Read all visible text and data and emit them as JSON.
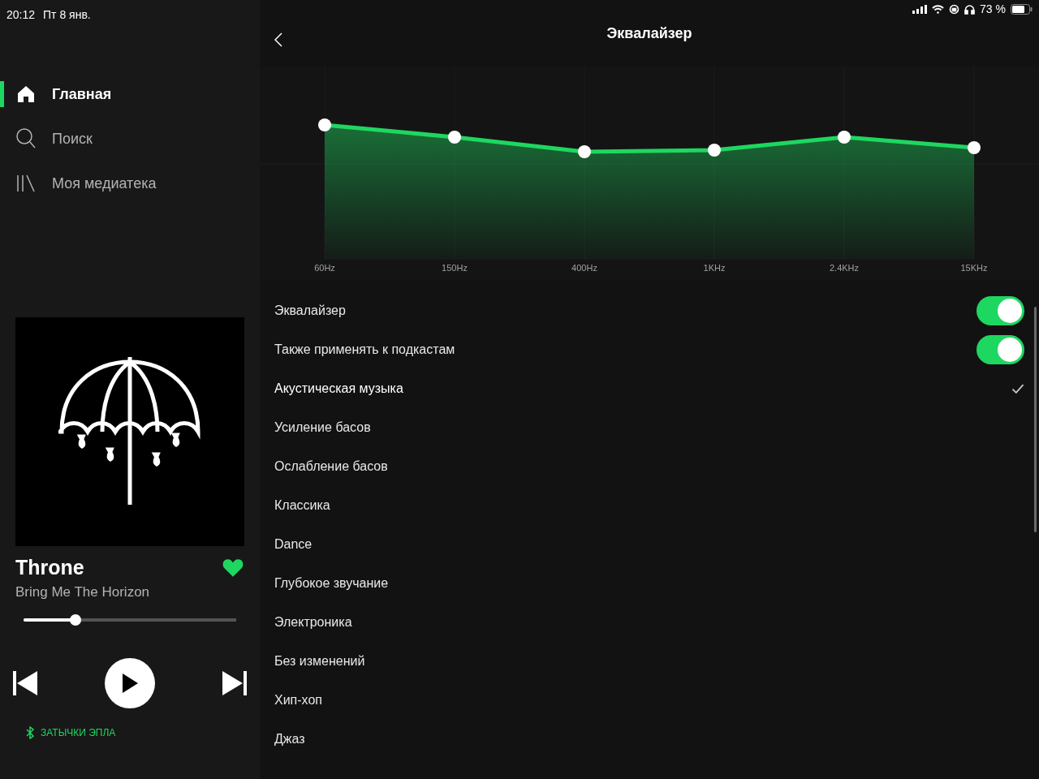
{
  "status_bar": {
    "time": "20:12",
    "date": "Пт 8 янв.",
    "battery_text": "73 %"
  },
  "sidebar": {
    "items": [
      {
        "label": "Главная",
        "selected": true
      },
      {
        "label": "Поиск",
        "selected": false
      },
      {
        "label": "Моя медиатека",
        "selected": false
      }
    ]
  },
  "now_playing": {
    "title": "Throne",
    "artist": "Bring Me The Horizon",
    "liked": true,
    "progress": {
      "level": 0.23
    },
    "playing": false,
    "device": "ЗАТЫЧКИ ЭПЛА"
  },
  "header": {
    "title": "Эквалайзер"
  },
  "equalizer": {
    "bands": [
      "60Hz",
      "150Hz",
      "400Hz",
      "1KHz",
      "2.4KHz",
      "15KHz"
    ]
  },
  "settings": [
    {
      "kind": "toggle",
      "label": "Эквалайзер",
      "on": true
    },
    {
      "kind": "toggle",
      "label": "Также применять к подкастам",
      "on": true
    },
    {
      "kind": "preset",
      "label": "Акустическая музыка",
      "selected": true
    },
    {
      "kind": "preset",
      "label": "Усиление басов",
      "selected": false
    },
    {
      "kind": "preset",
      "label": "Ослабление басов",
      "selected": false
    },
    {
      "kind": "preset",
      "label": "Классика",
      "selected": false
    },
    {
      "kind": "preset",
      "label": "Dance",
      "selected": false
    },
    {
      "kind": "preset",
      "label": "Глубокое звучание",
      "selected": false
    },
    {
      "kind": "preset",
      "label": "Электроника",
      "selected": false
    },
    {
      "kind": "preset",
      "label": "Без изменений",
      "selected": false
    },
    {
      "kind": "preset",
      "label": "Хип-хоп",
      "selected": false
    },
    {
      "kind": "preset",
      "label": "Джаз",
      "selected": false
    }
  ]
}
